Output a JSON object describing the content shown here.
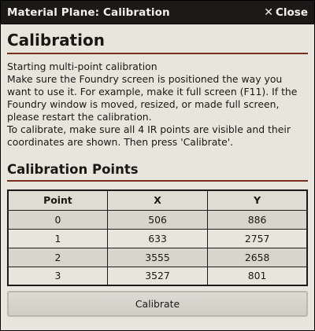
{
  "window": {
    "title": "Material Plane: Calibration",
    "close_label": "Close",
    "close_icon": "✕"
  },
  "main": {
    "title": "Calibration",
    "description": [
      "Starting multi-point calibration",
      "Make sure the Foundry screen is positioned the way you want to use it. For example, make it full screen (F11). If the Foundry window is moved, resized, or made full screen, please restart the calibration.",
      "To calibrate, make sure all 4 IR points are visible and their coordinates are shown. Then press 'Calibrate'."
    ]
  },
  "points_section": {
    "title": "Calibration Points",
    "headers": [
      "Point",
      "X",
      "Y"
    ],
    "rows": [
      [
        "0",
        "506",
        "886"
      ],
      [
        "1",
        "633",
        "2757"
      ],
      [
        "2",
        "3555",
        "2658"
      ],
      [
        "3",
        "3527",
        "801"
      ]
    ]
  },
  "calibrate_button": {
    "label": "Calibrate"
  },
  "colors": {
    "header_bg": "#1b1a18",
    "body_bg": "#e8e6dc",
    "accent_underline": "#782e22"
  }
}
